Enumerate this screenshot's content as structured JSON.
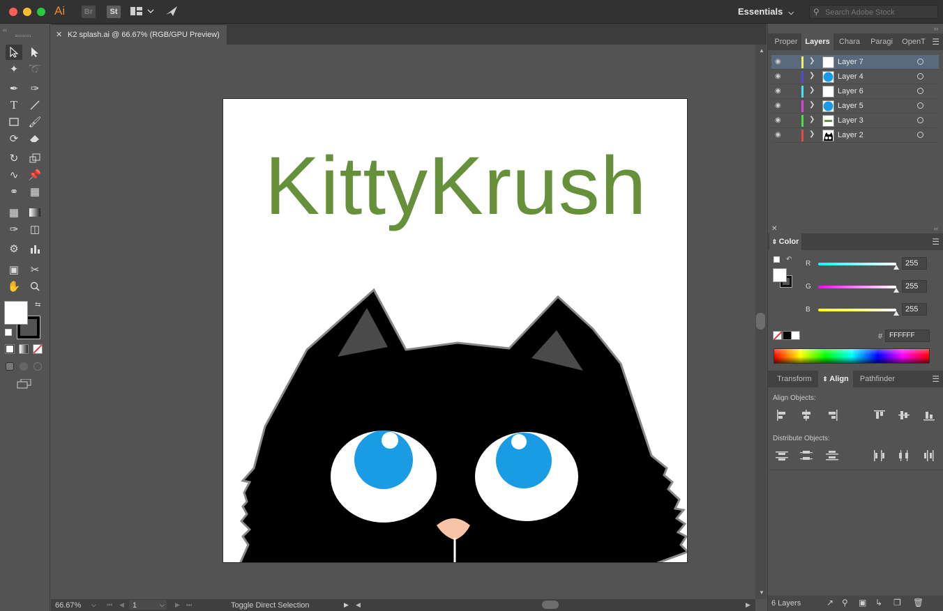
{
  "app": {
    "logo": "Ai",
    "bridge": "Br",
    "stock": "St",
    "workspace_label": "Essentials",
    "search_placeholder": "Search Adobe Stock"
  },
  "document": {
    "tab_title": "K2 splash.ai @ 66.67% (RGB/GPU Preview)",
    "artwork_text": "KittyKrush",
    "colors": {
      "title_green": "#66903a",
      "eye_blue": "#1a9ce5",
      "nose_pink": "#f8c4a8",
      "cat_black": "#000000"
    }
  },
  "statusbar": {
    "zoom": "66.67%",
    "artboard_number": "1",
    "hint": "Toggle Direct Selection"
  },
  "layers_panel": {
    "tabs": [
      "Proper",
      "Layers",
      "Chara",
      "Paragi",
      "OpenT"
    ],
    "active_tab": "Layers",
    "layers": [
      {
        "name": "Layer 7",
        "color": "#f5f062",
        "thumb": "white"
      },
      {
        "name": "Layer 4",
        "color": "#4a4adf",
        "thumb": "blue-circle"
      },
      {
        "name": "Layer 6",
        "color": "#45e4f0",
        "thumb": "white"
      },
      {
        "name": "Layer 5",
        "color": "#e040e0",
        "thumb": "blue-circle"
      },
      {
        "name": "Layer 3",
        "color": "#45e04a",
        "thumb": "text"
      },
      {
        "name": "Layer 2",
        "color": "#e04a4a",
        "thumb": "cat"
      }
    ],
    "footer_count": "6 Layers"
  },
  "color_panel": {
    "title": "Color",
    "channels": [
      {
        "label": "R",
        "value": "255"
      },
      {
        "label": "G",
        "value": "255"
      },
      {
        "label": "B",
        "value": "255"
      }
    ],
    "hex_label": "#",
    "hex_value": "FFFFFF"
  },
  "align_panel": {
    "tabs": [
      "Transform",
      "Align",
      "Pathfinder"
    ],
    "active_tab": "Align",
    "align_objects_label": "Align Objects:",
    "distribute_objects_label": "Distribute Objects:"
  }
}
